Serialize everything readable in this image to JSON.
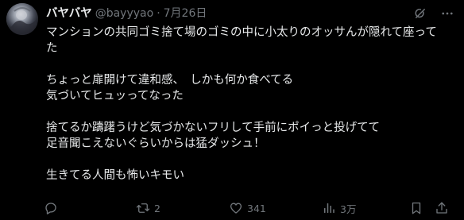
{
  "author": {
    "display_name": "バヤバヤ",
    "handle": "@bayyyao",
    "separator": "·",
    "date": "7月26日"
  },
  "tweet": {
    "lines": [
      "マンションの共同ゴミ捨て場のゴミの中に小太りのオッサんが隠れて座って",
      "た",
      "ちょっと扉開けて違和感、　しかも何か食べてる",
      "気づいてヒュッってなった",
      "捨てるか躊躇うけど気づかないフリして手前にポイっと投げてて",
      "足音聞こえないぐらいからは猛ダッシュ！",
      "生きてる人間も怖いキモい"
    ]
  },
  "top_actions": {
    "grok_icon": "grok-icon",
    "more_icon": "more-icon"
  },
  "actions": {
    "reply": {
      "icon": "reply-icon",
      "count": ""
    },
    "retweet": {
      "icon": "retweet-icon",
      "count": "2"
    },
    "like": {
      "icon": "like-icon",
      "count": "341"
    },
    "views": {
      "icon": "views-icon",
      "count": "3万"
    },
    "bookmark": {
      "icon": "bookmark-icon"
    },
    "share": {
      "icon": "share-icon"
    }
  },
  "colors": {
    "background": "#000000",
    "primary_text": "#e7e9ea",
    "secondary_text": "#71767b"
  }
}
